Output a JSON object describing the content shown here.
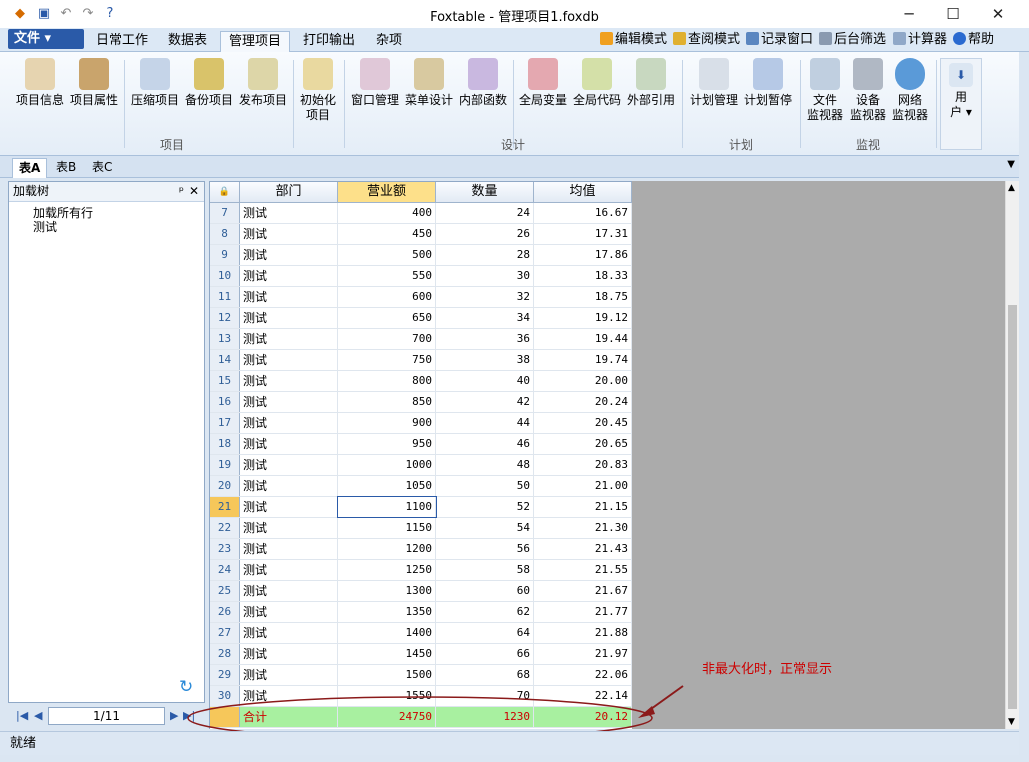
{
  "window": {
    "title": "Foxtable - 管理项目1.foxdb",
    "minimize": "─",
    "maximize": "☐",
    "close": "✕"
  },
  "menu": {
    "file": "文件 ▾",
    "tabs": [
      "日常工作",
      "数据表",
      "管理项目",
      "打印输出",
      "杂项"
    ],
    "tools": [
      "编辑模式",
      "查阅模式",
      "记录窗口",
      "后台筛选",
      "计算器",
      "帮助"
    ]
  },
  "ribbon": {
    "buttons": [
      "项目信息",
      "项目属性",
      "压缩项目",
      "备份项目",
      "发布项目",
      "初始化\n项目",
      "窗口管理",
      "菜单设计",
      "内部函数",
      "全局变量",
      "全局代码",
      "外部引用",
      "计划管理",
      "计划暂停",
      "文件\n监视器",
      "设备\n监视器",
      "网络\n监视器",
      "用\n户 ▾"
    ],
    "groups": [
      "项目",
      "设计",
      "计划",
      "监视"
    ]
  },
  "sheet_tabs": [
    "表A",
    "表B",
    "表C"
  ],
  "left_panel": {
    "title": "加载树",
    "pin": "ᵖ",
    "close": "✕",
    "tree": [
      "加载所有行",
      "测试"
    ],
    "refresh": "↻"
  },
  "nav": {
    "page": "1/11"
  },
  "grid": {
    "headers": [
      "部门",
      "营业额",
      "数量",
      "均值"
    ],
    "rows": [
      [
        "7",
        "测试",
        "400",
        "24",
        "16.67"
      ],
      [
        "8",
        "测试",
        "450",
        "26",
        "17.31"
      ],
      [
        "9",
        "测试",
        "500",
        "28",
        "17.86"
      ],
      [
        "10",
        "测试",
        "550",
        "30",
        "18.33"
      ],
      [
        "11",
        "测试",
        "600",
        "32",
        "18.75"
      ],
      [
        "12",
        "测试",
        "650",
        "34",
        "19.12"
      ],
      [
        "13",
        "测试",
        "700",
        "36",
        "19.44"
      ],
      [
        "14",
        "测试",
        "750",
        "38",
        "19.74"
      ],
      [
        "15",
        "测试",
        "800",
        "40",
        "20.00"
      ],
      [
        "16",
        "测试",
        "850",
        "42",
        "20.24"
      ],
      [
        "17",
        "测试",
        "900",
        "44",
        "20.45"
      ],
      [
        "18",
        "测试",
        "950",
        "46",
        "20.65"
      ],
      [
        "19",
        "测试",
        "1000",
        "48",
        "20.83"
      ],
      [
        "20",
        "测试",
        "1050",
        "50",
        "21.00"
      ],
      [
        "21",
        "测试",
        "1100",
        "52",
        "21.15"
      ],
      [
        "22",
        "测试",
        "1150",
        "54",
        "21.30"
      ],
      [
        "23",
        "测试",
        "1200",
        "56",
        "21.43"
      ],
      [
        "24",
        "测试",
        "1250",
        "58",
        "21.55"
      ],
      [
        "25",
        "测试",
        "1300",
        "60",
        "21.67"
      ],
      [
        "26",
        "测试",
        "1350",
        "62",
        "21.77"
      ],
      [
        "27",
        "测试",
        "1400",
        "64",
        "21.88"
      ],
      [
        "28",
        "测试",
        "1450",
        "66",
        "21.97"
      ],
      [
        "29",
        "测试",
        "1500",
        "68",
        "22.06"
      ],
      [
        "30",
        "测试",
        "1550",
        "70",
        "22.14"
      ]
    ],
    "total": [
      "合计",
      "24750",
      "1230",
      "20.12"
    ]
  },
  "annotation": "非最大化时，正常显示",
  "status": "就绪"
}
